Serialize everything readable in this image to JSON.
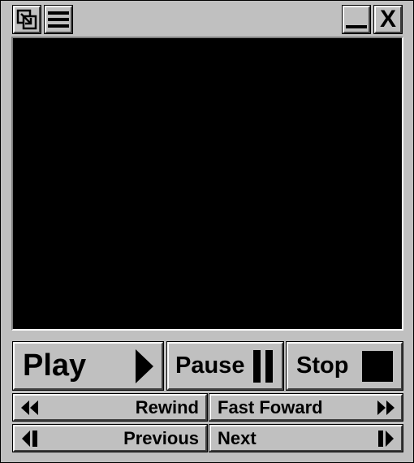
{
  "titlebar": {
    "buttons": {
      "restore_icon": "restore-icon",
      "menu_icon": "menu-icon",
      "minimize_icon": "minimize-icon",
      "close_label": "X"
    }
  },
  "video": {
    "background": "#000000"
  },
  "controls": {
    "play_label": "Play",
    "pause_label": "Pause",
    "stop_label": "Stop",
    "rewind_label": "Rewind",
    "fast_forward_label": "Fast Foward",
    "previous_label": "Previous",
    "next_label": "Next"
  },
  "colors": {
    "face": "#c0c0c0",
    "highlight": "#ffffff",
    "shadow": "#404040",
    "text": "#000000"
  }
}
